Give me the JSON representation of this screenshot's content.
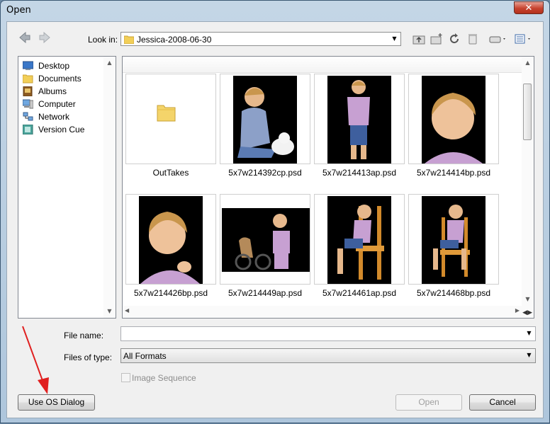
{
  "window": {
    "title": "Open",
    "close_glyph": "✕"
  },
  "toolbar": {
    "look_in_label": "Look in:",
    "look_in_value": "Jessica-2008-06-30",
    "icons": [
      "back-arrow-icon",
      "forward-arrow-icon",
      "up-folder-icon",
      "new-folder-icon",
      "refresh-icon",
      "delete-icon",
      "drives-icon",
      "view-menu-icon"
    ]
  },
  "sidebar": {
    "items": [
      {
        "label": "Desktop",
        "icon": "desktop-icon"
      },
      {
        "label": "Documents",
        "icon": "documents-icon"
      },
      {
        "label": "Albums",
        "icon": "albums-icon"
      },
      {
        "label": "Computer",
        "icon": "computer-icon"
      },
      {
        "label": "Network",
        "icon": "network-icon"
      },
      {
        "label": "Version Cue",
        "icon": "version-cue-icon"
      }
    ]
  },
  "files": [
    {
      "name": "OutTakes",
      "type": "folder"
    },
    {
      "name": "5x7w214392cp.psd",
      "type": "image"
    },
    {
      "name": "5x7w214413ap.psd",
      "type": "image"
    },
    {
      "name": "5x7w214414bp.psd",
      "type": "image"
    },
    {
      "name": "5x7w214426bp.psd",
      "type": "image"
    },
    {
      "name": "5x7w214449ap.psd",
      "type": "image"
    },
    {
      "name": "5x7w214461ap.psd",
      "type": "image"
    },
    {
      "name": "5x7w214468bp.psd",
      "type": "image"
    }
  ],
  "form": {
    "file_name_label": "File name:",
    "file_name_value": "",
    "files_of_type_label": "Files of type:",
    "files_of_type_value": "All Formats",
    "image_sequence_label": "Image Sequence",
    "image_sequence_checked": false
  },
  "buttons": {
    "use_os_dialog": "Use OS Dialog",
    "open": "Open",
    "cancel": "Cancel"
  },
  "annotation": {
    "color": "#e02020"
  }
}
